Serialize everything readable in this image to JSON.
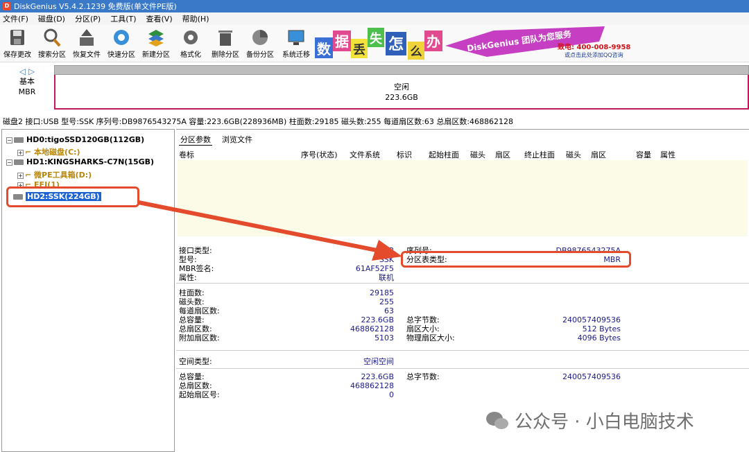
{
  "window": {
    "title": "DiskGenius V5.4.2.1239 免费版(单文件PE版)"
  },
  "menu": [
    "文件(F)",
    "磁盘(D)",
    "分区(P)",
    "工具(T)",
    "查看(V)",
    "帮助(H)"
  ],
  "toolbar": [
    {
      "label": "保存更改",
      "icon": "save-icon"
    },
    {
      "label": "搜索分区",
      "icon": "magnifier-icon"
    },
    {
      "label": "恢复文件",
      "icon": "upload-box-icon"
    },
    {
      "label": "快速分区",
      "icon": "globe-icon"
    },
    {
      "label": "新建分区",
      "icon": "layers-icon"
    },
    {
      "label": "格式化",
      "icon": "gear-icon"
    },
    {
      "label": "删除分区",
      "icon": "trash-icon"
    },
    {
      "label": "备份分区",
      "icon": "pie-icon"
    },
    {
      "label": "系统迁移",
      "icon": "monitor-icon"
    }
  ],
  "banner": {
    "chars": [
      "数",
      "据",
      "丢",
      "失",
      "怎",
      "么",
      "办"
    ],
    "slogan": "DiskGenius 团队为您服务",
    "phone": "致电: 400-008-9958",
    "qq": "或点击此处添加QQ咨询"
  },
  "disk_nav": {
    "type": "基本",
    "scheme": "MBR"
  },
  "disk_bar": {
    "label": "空闲",
    "size": "223.6GB"
  },
  "disk_info": "磁盘2 接口:USB  型号:SSK  序列号:DB9876543275A  容量:223.6GB(228936MB)  柱面数:29185  磁头数:255  每道扇区数:63  总扇区数:468862128",
  "tree": [
    {
      "label": "HD0:tigoSSD120GB(112GB)",
      "kind": "disk"
    },
    {
      "label": "本地磁盘(C:)",
      "kind": "part"
    },
    {
      "label": "HD1:KINGSHARKS-C7N(15GB)",
      "kind": "disk"
    },
    {
      "label": "微PE工具箱(D:)",
      "kind": "part"
    },
    {
      "label": "EFI(1)",
      "kind": "part"
    },
    {
      "label": "HD2:SSK(224GB)",
      "kind": "disk-selected"
    }
  ],
  "tabs": [
    "分区参数",
    "浏览文件"
  ],
  "columns": [
    "卷标",
    "序号(状态)",
    "文件系统",
    "标识",
    "起始柱面",
    "磁头",
    "扇区",
    "终止柱面",
    "磁头",
    "扇区",
    "容量",
    "属性"
  ],
  "details1": {
    "interface_label": "接口类型:",
    "interface_value": "USB",
    "model_label": "型号:",
    "model_value": "SSK",
    "mbr_label": "MBR签名:",
    "mbr_value": "61AF52F5",
    "attr_label": "属性:",
    "attr_value": "联机",
    "serial_label": "序列号:",
    "serial_value": "DB9876543275A",
    "pt_label": "分区表类型:",
    "pt_value": "MBR"
  },
  "details2": {
    "cyl_label": "柱面数:",
    "cyl_value": "29185",
    "heads_label": "磁头数:",
    "heads_value": "255",
    "spt_label": "每道扇区数:",
    "spt_value": "63",
    "cap_label": "总容量:",
    "cap_value": "223.6GB",
    "sectors_label": "总扇区数:",
    "sectors_value": "468862128",
    "extra_label": "附加扇区数:",
    "extra_value": "5103",
    "bytes_label": "总字节数:",
    "bytes_value": "240057409536",
    "secsize_label": "扇区大小:",
    "secsize_value": "512 Bytes",
    "physec_label": "物理扇区大小:",
    "physec_value": "4096 Bytes"
  },
  "details3": {
    "space_label": "空间类型:",
    "space_value": "空闲空间",
    "cap_label": "总容量:",
    "cap_value": "223.6GB",
    "sectors_label": "总扇区数:",
    "sectors_value": "468862128",
    "start_label": "起始扇区号:",
    "start_value": "0",
    "bytes_label": "总字节数:",
    "bytes_value": "240057409536"
  },
  "watermark": "公众号 · 小白电脑技术",
  "colors": {
    "highlight": "#e34b2c",
    "selection": "#1e63d4",
    "free_border": "#c2185b"
  }
}
